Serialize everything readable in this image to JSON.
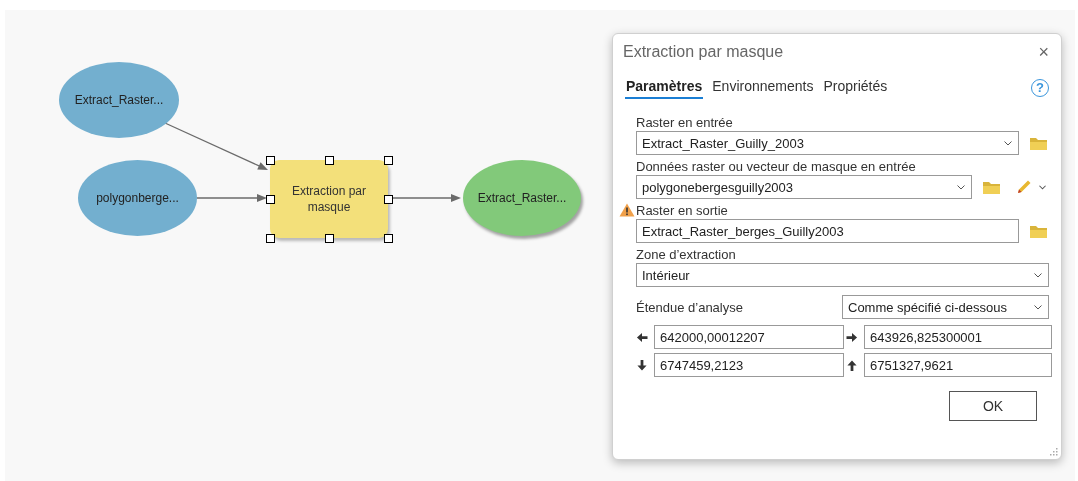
{
  "diagram": {
    "nodes": [
      {
        "kind": "data",
        "label": "Extract_Raster...",
        "color": "#73afcf",
        "selected": false
      },
      {
        "kind": "data",
        "label": "polygonberge...",
        "color": "#73afcf",
        "selected": false
      },
      {
        "kind": "tool",
        "label": "Extraction par masque",
        "color": "#f3e07a",
        "selected": true
      },
      {
        "kind": "output",
        "label": "Extract_Raster...",
        "color": "#82c97a",
        "selected": false
      }
    ]
  },
  "dialog": {
    "title": "Extraction par masque",
    "close": "×",
    "help": "?",
    "tabs": [
      {
        "label": "Paramètres",
        "selected": true
      },
      {
        "label": "Environnements",
        "selected": false
      },
      {
        "label": "Propriétés",
        "selected": false
      }
    ],
    "params": [
      {
        "kind": "select",
        "label": "Raster en entrée",
        "value": "Extract_Raster_Guilly_2003",
        "browse": true,
        "edit": false,
        "warning": false
      },
      {
        "kind": "select",
        "label": "Données raster ou vecteur de masque en entrée",
        "value": "polygonebergesguilly2003",
        "browse": true,
        "edit": true,
        "warning": false
      },
      {
        "kind": "text",
        "label": "Raster en sortie",
        "value": "Extract_Raster_berges_Guilly2003",
        "browse": true,
        "edit": false,
        "warning": true
      },
      {
        "kind": "select",
        "label": "Zone d’extraction",
        "value": "Intérieur",
        "browse": false,
        "edit": false,
        "warning": false
      }
    ],
    "extent": {
      "label": "Étendue d’analyse",
      "mode": "Comme spécifié ci-dessous",
      "coords": [
        {
          "kind": "left",
          "value": "642000,00012207"
        },
        {
          "kind": "right",
          "value": "643926,825300001"
        },
        {
          "kind": "down",
          "value": "6747459,2123"
        },
        {
          "kind": "up",
          "value": "6751327,9621"
        }
      ]
    },
    "ok": "OK"
  }
}
